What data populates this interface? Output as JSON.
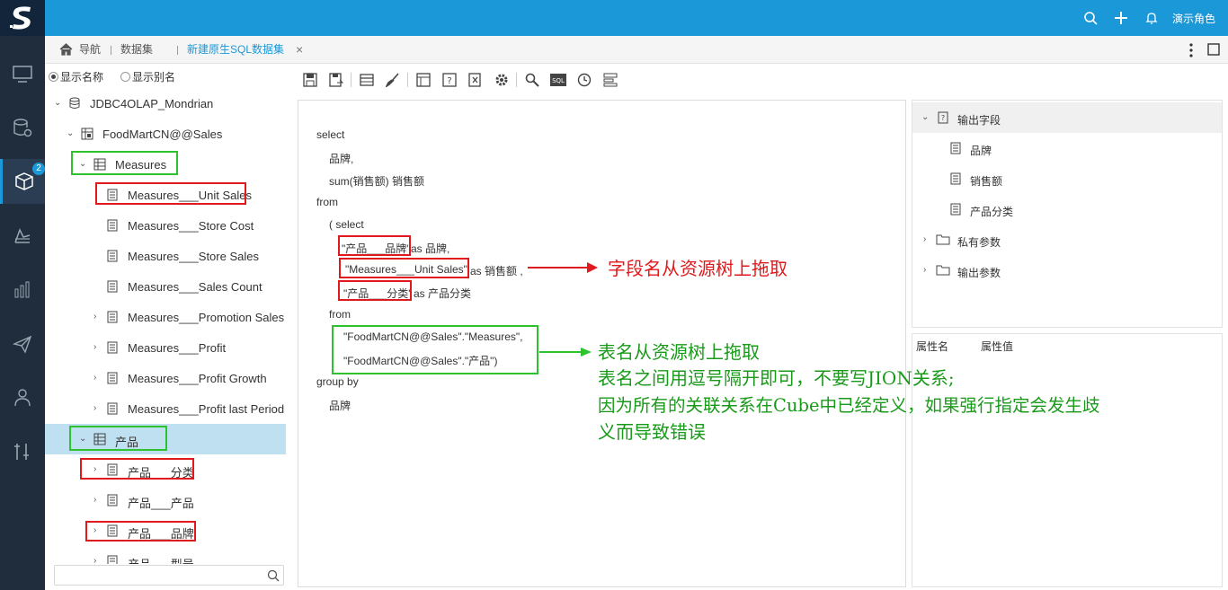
{
  "header": {
    "user_label": "演示角色",
    "icons": [
      "search-icon",
      "plus-icon",
      "bell-icon"
    ]
  },
  "nav": {
    "items": [
      "monitor-icon",
      "database-settings-icon",
      "cube-icon",
      "report-icon",
      "chart-icon",
      "send-icon",
      "network-icon",
      "tools-icon"
    ],
    "badge": "2"
  },
  "tabs": {
    "home": "导航",
    "dataset": "数据集",
    "active": "新建原生SQL数据集",
    "close": "×"
  },
  "tree": {
    "radio_name": "显示名称",
    "radio_alias": "显示别名",
    "items": [
      "JDBC4OLAP_Mondrian",
      "FoodMartCN@@Sales",
      "Measures",
      "Measures___Unit Sales",
      "Measures___Store Cost",
      "Measures___Store Sales",
      "Measures___Sales Count",
      "Measures___Promotion Sales",
      "Measures___Profit",
      "Measures___Profit Growth",
      "Measures___Profit last Period",
      "产品",
      "产品___分类",
      "产品___产品",
      "产品___品牌",
      "产品___型号"
    ],
    "search_placeholder": ""
  },
  "toolbar": {
    "icons": [
      "save-icon",
      "save-as-icon",
      "table-icon",
      "brush-icon",
      "properties-icon",
      "parameter-icon",
      "export-icon",
      "settings-icon",
      "search-icon",
      "sql-icon",
      "clock-icon",
      "layout-icon"
    ]
  },
  "editor": {
    "lines": [
      "select",
      "品牌,",
      "sum(销售额)  销售额",
      "from",
      "(     select",
      "\"产品___品牌\"",
      " as 品牌,",
      "\"Measures___Unit Sales\"",
      "as 销售额 ,",
      "\"产品___分类\"",
      " as 产品分类",
      "from",
      "\"FoodMartCN@@Sales\".\"Measures\",",
      "\"FoodMartCN@@Sales\".\"产品\")",
      "group by",
      "品牌"
    ]
  },
  "output": {
    "root": "输出字段",
    "fields": [
      "品牌",
      "销售额",
      "产品分类"
    ],
    "private_params": "私有参数",
    "output_params": "输出参数"
  },
  "properties": {
    "col_name": "属性名",
    "col_value": "属性值"
  },
  "annotations": {
    "red_note": "字段名从资源树上拖取",
    "green_line1": "表名从资源树上拖取",
    "green_line2": "表名之间用逗号隔开即可，不要写JION关系;",
    "green_line3": "因为所有的关联关系在Cube中已经定义，如果强行指定会发生歧",
    "green_line4": "义而导致错误"
  }
}
